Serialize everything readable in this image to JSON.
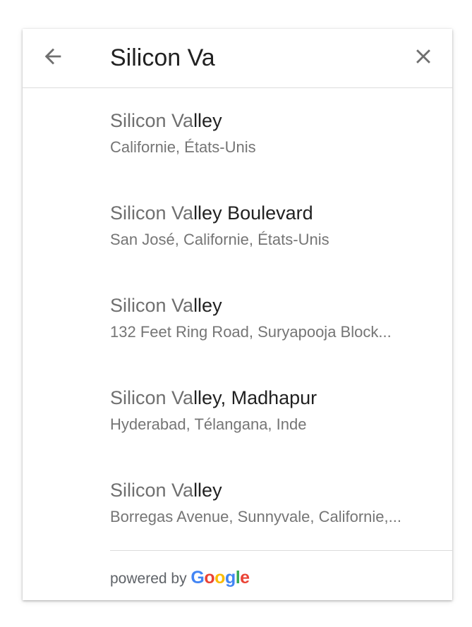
{
  "search": {
    "value": "Silicon Va",
    "back_icon": "arrow-left-icon",
    "clear_icon": "close-icon"
  },
  "results": [
    {
      "match": "Silicon Va",
      "rest": "lley",
      "subtitle": "Californie, États-Unis"
    },
    {
      "match": "Silicon Va",
      "rest": "lley Boulevard",
      "subtitle": "San José, Californie, États-Unis"
    },
    {
      "match": "Silicon Va",
      "rest": "lley",
      "subtitle": "132 Feet Ring Road, Suryapooja Block..."
    },
    {
      "match": "Silicon Va",
      "rest": "lley, Madhapur",
      "subtitle": "Hyderabad, Télangana, Inde"
    },
    {
      "match": "Silicon Va",
      "rest": "lley",
      "subtitle": "Borregas Avenue, Sunnyvale, Californie,..."
    }
  ],
  "footer": {
    "powered_by": "powered by",
    "logo": {
      "letters": [
        "G",
        "o",
        "o",
        "g",
        "l",
        "e"
      ],
      "colors": [
        "#4285F4",
        "#EA4335",
        "#FBBC05",
        "#4285F4",
        "#34A853",
        "#EA4335"
      ]
    }
  },
  "colors": {
    "icon": "#6f6f6f",
    "text_primary": "#212121",
    "text_secondary": "#757575",
    "divider": "#dcdcdc"
  }
}
